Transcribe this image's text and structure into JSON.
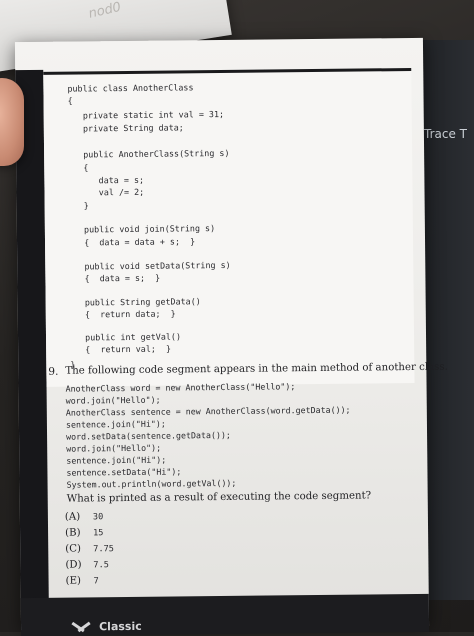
{
  "background": {
    "top_paper_text": "nod0",
    "right_screen_label": "Trace T"
  },
  "code": {
    "lines": [
      "public class AnotherClass",
      "{",
      "   private static int val = 31;",
      "   private String data;",
      "",
      "   public AnotherClass(String s)",
      "   {",
      "      data = s;",
      "      val /= 2;",
      "   }",
      "",
      "   public void join(String s)",
      "   {  data = data + s;  }",
      "",
      "   public void setData(String s)",
      "   {  data = s;  }",
      "",
      "   public String getData()",
      "   {  return data;  }",
      "",
      "   public int getVal()",
      "   {  return val;  }",
      "}"
    ]
  },
  "question": {
    "number": "9.",
    "text": "The following code segment appears in the main method of another class.",
    "segment": [
      "AnotherClass word = new AnotherClass(\"Hello\");",
      "word.join(\"Hello\");",
      "AnotherClass sentence = new AnotherClass(word.getData());",
      "sentence.join(\"Hi\");",
      "word.setData(sentence.getData());",
      "word.join(\"Hello\");",
      "sentence.join(\"Hi\");",
      "sentence.setData(\"Hi\");",
      "System.out.println(word.getVal());"
    ],
    "prompt": "What is printed as a result of executing the code segment?",
    "choices": [
      {
        "letter": "(A)",
        "value": "30"
      },
      {
        "letter": "(B)",
        "value": "15"
      },
      {
        "letter": "(C)",
        "value": "7.75"
      },
      {
        "letter": "(D)",
        "value": "7.5"
      },
      {
        "letter": "(E)",
        "value": "7"
      }
    ]
  },
  "footer": {
    "brand": "Classic"
  }
}
